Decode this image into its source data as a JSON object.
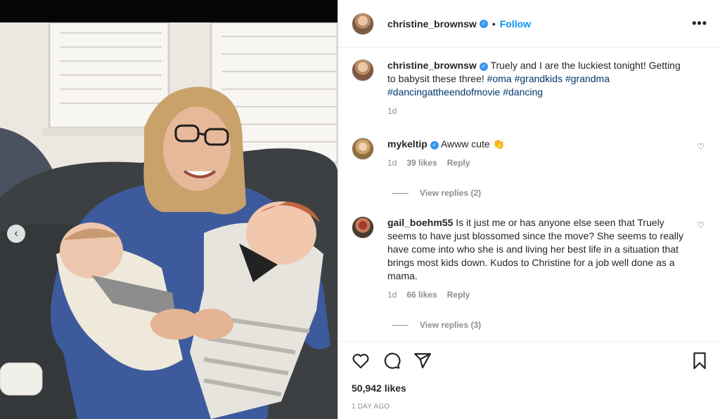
{
  "post": {
    "author": "christine_brownsw",
    "follow_label": "Follow",
    "more_label": "•••",
    "caption": {
      "username": "christine_brownsw",
      "text": "Truely and I are the luckiest tonight! Getting to babysit these three!",
      "hashtags": [
        "#oma",
        "#grandkids",
        "#grandma",
        "#dancingattheendofmovie",
        "#dancing"
      ],
      "age": "1d"
    },
    "comments": [
      {
        "username": "mykeltip",
        "verified": true,
        "text": "Awww cute 👏",
        "age": "1d",
        "likes": "39 likes",
        "reply_label": "Reply",
        "view_replies": "View replies (2)"
      },
      {
        "username": "gail_boehm55",
        "verified": false,
        "text": "Is it just me or has anyone else seen that Truely seems to have just blossomed since the move? She seems to really have come into who she is and living her best life in a situation that brings most kids down. Kudos to Christine for a job well done as a mama.",
        "age": "1d",
        "likes": "66 likes",
        "reply_label": "Reply",
        "view_replies": "View replies (3)"
      }
    ],
    "likes_count": "50,942 likes",
    "timestamp": "1 DAY AGO",
    "icons": {
      "like": "heart-icon",
      "comment": "comment-icon",
      "share": "paper-plane-icon",
      "save": "bookmark-icon",
      "prev": "chevron-left-icon"
    }
  }
}
